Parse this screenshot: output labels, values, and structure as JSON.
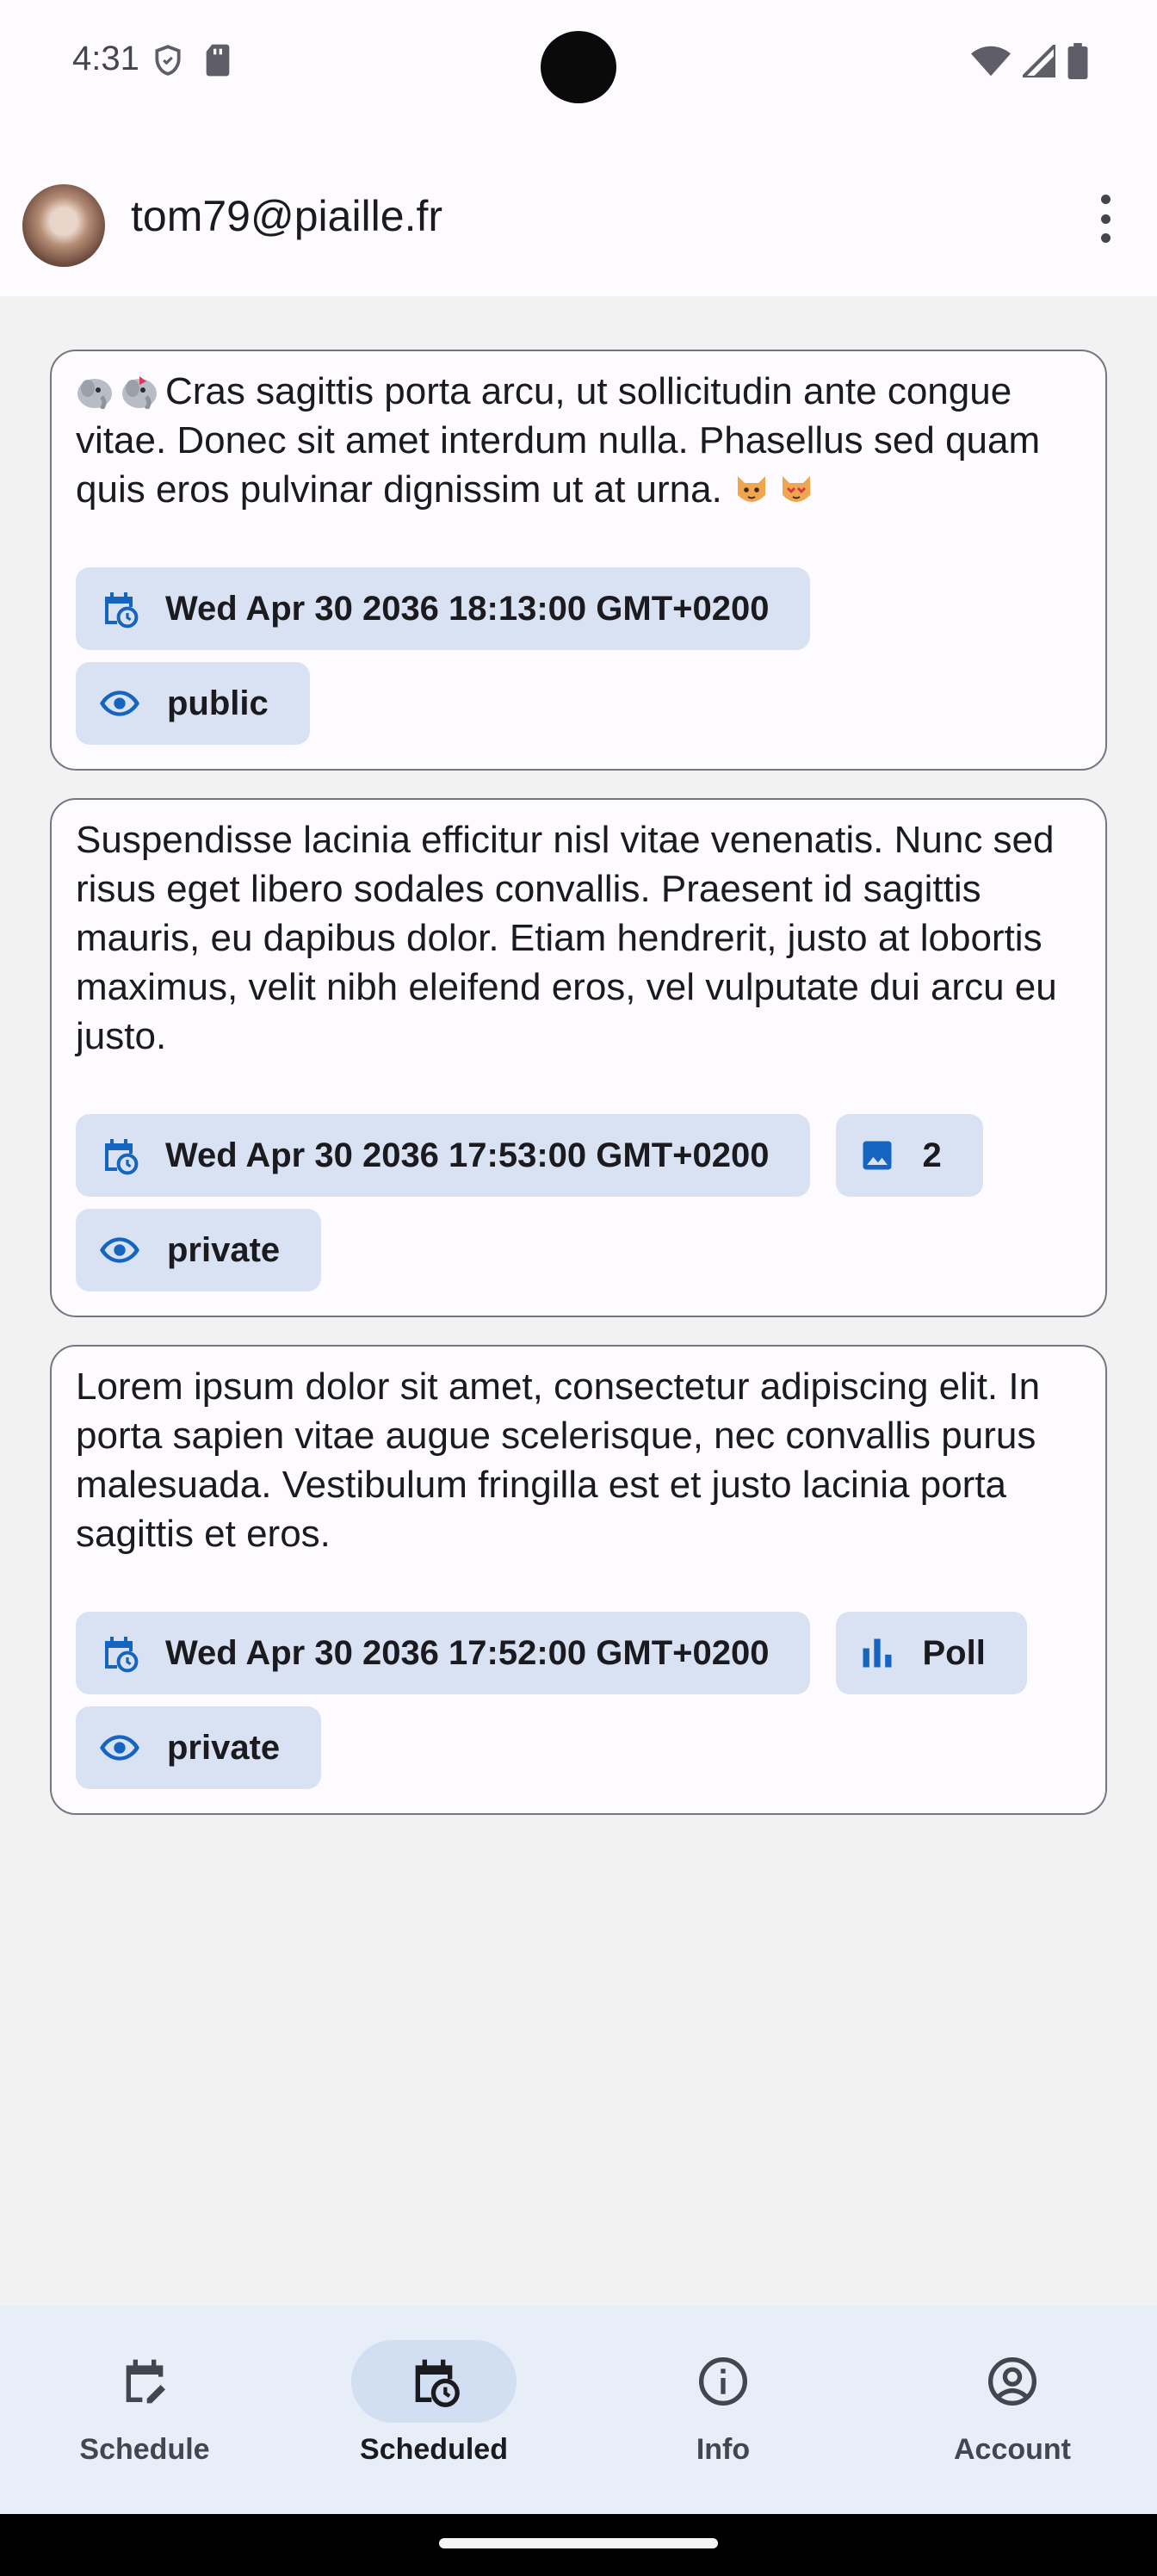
{
  "status_bar": {
    "time": "4:31"
  },
  "app_bar": {
    "account": "tom79@piaille.fr"
  },
  "posts": [
    {
      "leading_emoji": [
        "mastodon-emoji",
        "mastodon-emoji"
      ],
      "text": "Cras sagittis porta arcu, ut sollicitudin ante congue vitae. Donec sit amet interdum nulla. Phasellus sed quam quis eros pulvinar dignissim ut at urna.",
      "trailing_emoji": [
        "cat-emoji",
        "cat-emoji"
      ],
      "date": "Wed Apr 30 2036 18:13:00 GMT+0200",
      "visibility": "public"
    },
    {
      "text": "Suspendisse lacinia efficitur nisl vitae venenatis. Nunc sed risus eget libero sodales convallis. Praesent id sagittis mauris, eu dapibus dolor. Etiam hendrerit, justo at lobortis maximus, velit nibh eleifend eros, vel vulputate dui arcu eu justo.",
      "date": "Wed Apr 30 2036 17:53:00 GMT+0200",
      "media_count": "2",
      "visibility": "private"
    },
    {
      "text": "Lorem ipsum dolor sit amet, consectetur adipiscing elit. In porta sapien vitae augue scelerisque, nec convallis purus malesuada. Vestibulum fringilla est et justo lacinia porta sagittis et eros.",
      "date": "Wed Apr 30 2036 17:52:00 GMT+0200",
      "poll_label": "Poll",
      "visibility": "private"
    }
  ],
  "nav": {
    "items": [
      {
        "label": "Schedule",
        "icon": "edit-calendar-icon"
      },
      {
        "label": "Scheduled",
        "icon": "scheduled-calendar-icon"
      },
      {
        "label": "Info",
        "icon": "info-icon"
      },
      {
        "label": "Account",
        "icon": "account-circle-icon"
      }
    ],
    "active_index": 1
  },
  "colors": {
    "accent": "#1565c0",
    "chip": "#d9e2f3",
    "nav_bg": "#e8eef8",
    "nav_pill": "#d2dff2"
  }
}
